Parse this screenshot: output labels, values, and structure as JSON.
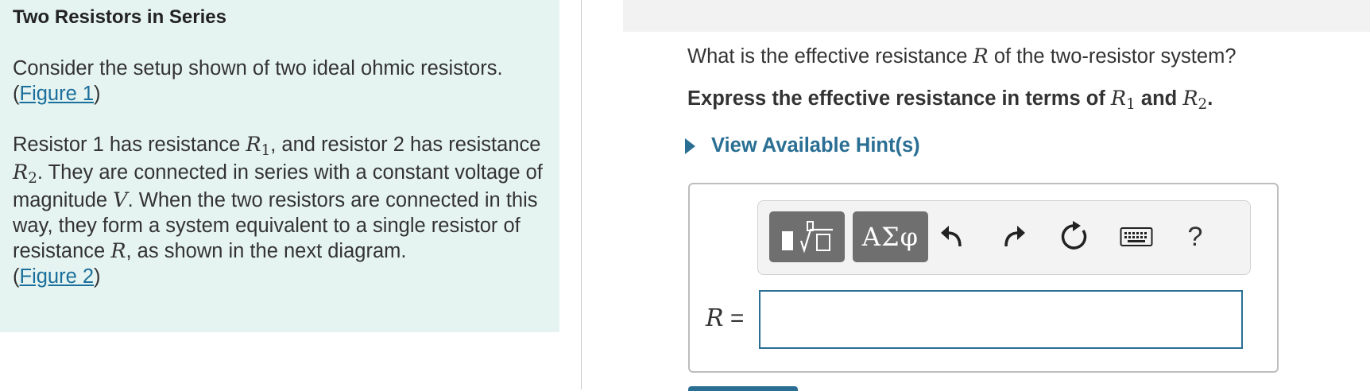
{
  "problem": {
    "title": "Two Resistors in Series",
    "p1_text": "Consider the setup shown of two ideal ohmic resistors.",
    "fig1_open": "(",
    "fig1_link": "Figure 1",
    "fig1_close": ")",
    "p2_a": "Resistor 1 has resistance ",
    "p2_b": ", and resistor 2 has resistance ",
    "p2_c": ". They are connected in series with a constant voltage of magnitude ",
    "p2_d": ". When the two resistors are connected in this way, they form a system equivalent to a single resistor of resistance ",
    "p2_e": ", as shown in the next diagram.",
    "fig2_open": "(",
    "fig2_link": "Figure 2",
    "fig2_close": ")"
  },
  "math": {
    "R": "R",
    "R_sub1": "1",
    "R_sub2": "2",
    "V": "V"
  },
  "part": {
    "question_a": "What is the effective resistance ",
    "question_b": " of the two-resistor system?",
    "instruction_a": "Express the effective resistance in terms of ",
    "instruction_and": " and ",
    "instruction_end": ".",
    "hints_label": "View Available Hint(s)"
  },
  "toolbar": {
    "greek_label": "ΑΣφ",
    "help_label": "?",
    "icons": [
      "templates-icon",
      "greek-symbols-icon",
      "undo-icon",
      "redo-icon",
      "reset-icon",
      "keyboard-icon",
      "help-icon"
    ]
  },
  "answer": {
    "label_var": "R",
    "label_eq": " =",
    "value": ""
  },
  "colors": {
    "panel_bg": "#e6f4f1",
    "accent": "#2a6f93",
    "toolbar_button": "#6f6f6f"
  }
}
